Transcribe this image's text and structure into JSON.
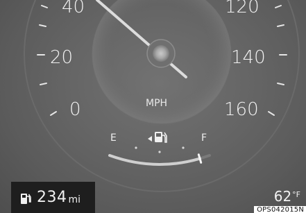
{
  "speedometer": {
    "labels": {
      "s0": "0",
      "s20": "20",
      "s40": "40",
      "s120": "120",
      "s140": "140",
      "s160": "160"
    },
    "unit": "MPH"
  },
  "fuel_gauge": {
    "empty_label": "E",
    "full_label": "F",
    "fill_fraction": 0.9,
    "icon": "fuel-pump-icon"
  },
  "range_display": {
    "value": "234",
    "unit": "mi",
    "icon": "fuel-pump-icon"
  },
  "outside_temp": {
    "value": "62",
    "unit": "°F"
  },
  "photo_code": "OPS042015N",
  "colors": {
    "background": "#666666",
    "text": "#f2f2f2",
    "range_box": "#1e1e1e"
  }
}
